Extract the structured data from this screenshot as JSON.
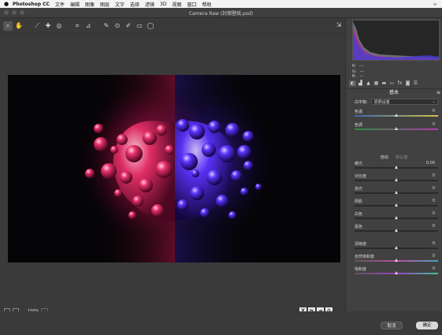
{
  "menubar": {
    "app": "Photoshop CC",
    "items": [
      "文件",
      "编辑",
      "图像",
      "图层",
      "文字",
      "选择",
      "滤镜",
      "3D",
      "视图",
      "窗口",
      "帮助"
    ]
  },
  "window": {
    "title": "Camera Raw (封案壁纸.psd)"
  },
  "toolbar": {
    "tools": [
      {
        "icon": "zoom-tool-icon",
        "glyph": "⌕"
      },
      {
        "icon": "hand-tool-icon",
        "glyph": "✋"
      },
      {
        "icon": "white-balance-tool-icon",
        "glyph": "⟋"
      },
      {
        "icon": "color-sampler-icon",
        "glyph": "✚"
      },
      {
        "icon": "targeted-adjustment-icon",
        "glyph": "◎"
      },
      {
        "icon": "crop-tool-icon",
        "glyph": "⌗"
      },
      {
        "icon": "straighten-tool-icon",
        "glyph": "⊿"
      },
      {
        "icon": "spot-removal-icon",
        "glyph": "✎"
      },
      {
        "icon": "red-eye-icon",
        "glyph": "⊙"
      },
      {
        "icon": "adjustment-brush-icon",
        "glyph": "✐"
      },
      {
        "icon": "graduated-filter-icon",
        "glyph": "▭"
      },
      {
        "icon": "radial-filter-icon",
        "glyph": "◯"
      }
    ]
  },
  "status": {
    "zoom": "100%"
  },
  "readout": {
    "r_label": "R:",
    "g_label": "G:",
    "b_label": "B:",
    "r": "---",
    "g": "---",
    "b": "---"
  },
  "panel": {
    "title": "基本",
    "white_balance_label": "白平衡:",
    "white_balance_value": "原照设置",
    "auto_label": "自动",
    "default_label": "默认值"
  },
  "sliders": [
    {
      "label": "色温",
      "value": "0",
      "level": 0.5
    },
    {
      "label": "色调",
      "value": "0",
      "level": 0.5
    },
    {
      "label": "曝光",
      "value": "0.00",
      "level": 0.5
    },
    {
      "label": "对比度",
      "value": "0",
      "level": 0.5
    },
    {
      "label": "高光",
      "value": "0",
      "level": 0.5
    },
    {
      "label": "阴影",
      "value": "0",
      "level": 0.5
    },
    {
      "label": "白色",
      "value": "0",
      "level": 0.5
    },
    {
      "label": "黑色",
      "value": "0",
      "level": 0.5
    },
    {
      "label": "清晰度",
      "value": "0",
      "level": 0.5
    },
    {
      "label": "自然饱和度",
      "value": "0",
      "level": 0.5
    },
    {
      "label": "饱和度",
      "value": "0",
      "level": 0.5
    }
  ],
  "buttons": {
    "cancel": "取消",
    "ok": "确定"
  },
  "colors": {
    "accent_red": "#ff2f6e",
    "accent_blue": "#5a32ff"
  }
}
